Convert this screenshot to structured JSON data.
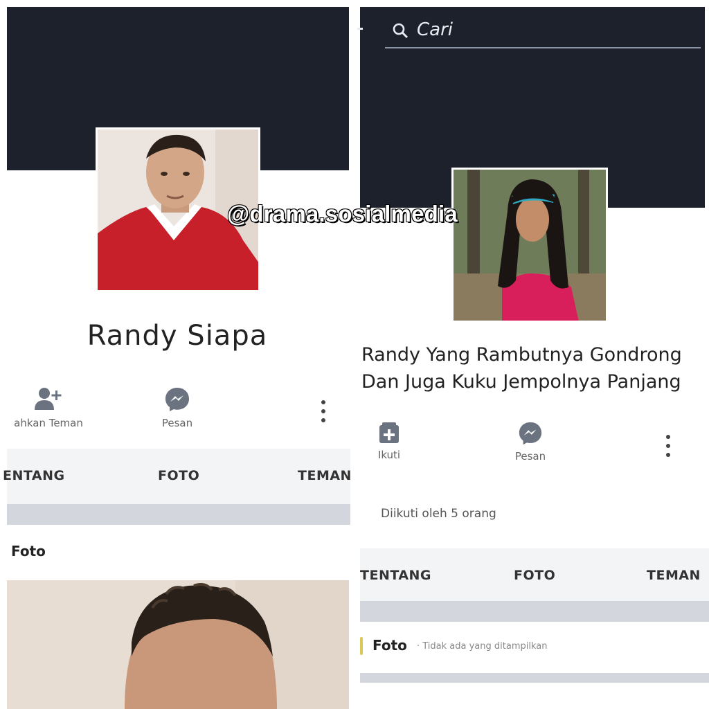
{
  "watermark": "@drama.sosialmedia",
  "left_profile": {
    "name": "Randy Siapa",
    "actions": [
      {
        "label": "ahkan Teman",
        "icon": "add-friend-icon"
      },
      {
        "label": "Pesan",
        "icon": "messenger-icon"
      }
    ],
    "tabs": [
      "ENTANG",
      "FOTO",
      "TEMAN"
    ],
    "section_title": "Foto"
  },
  "right_profile": {
    "search_placeholder": "Cari",
    "name_line1": "Randy Yang Rambutnya Gondrong",
    "name_line2": "Dan Juga Kuku Jempolnya Panjang",
    "actions": [
      {
        "label": "Ikuti",
        "icon": "follow-icon"
      },
      {
        "label": "Pesan",
        "icon": "messenger-icon"
      }
    ],
    "followers": "Diikuti oleh 5 orang",
    "tabs": [
      "TENTANG",
      "FOTO",
      "TEMAN"
    ],
    "section_title": "Foto",
    "section_subtitle": "· Tidak ada yang ditampilkan"
  },
  "colors": {
    "cover": "#1c212b",
    "jersey_red": "#c8202a",
    "shirt_pink": "#d81e5b"
  }
}
